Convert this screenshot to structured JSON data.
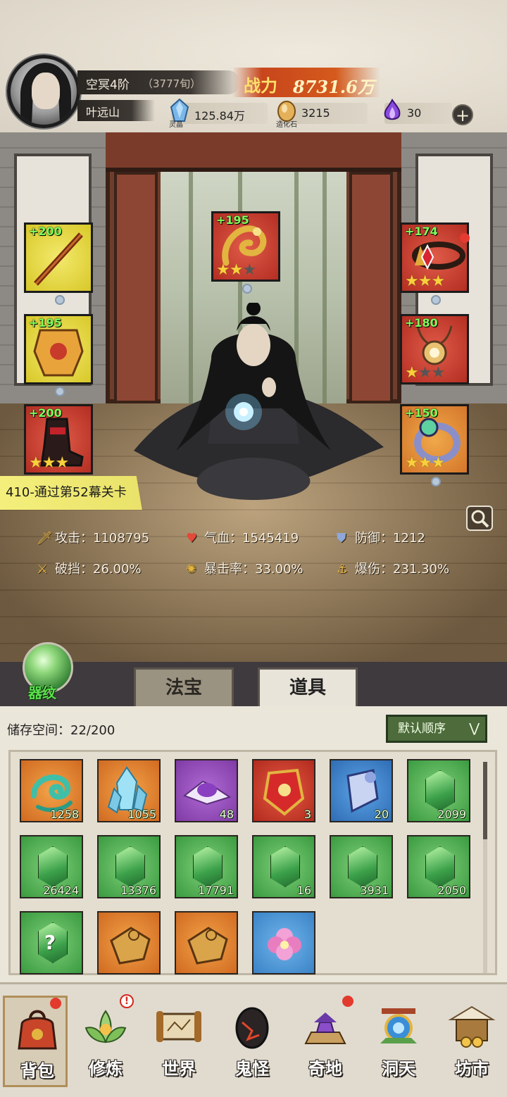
{
  "header": {
    "realm": "空冥4阶",
    "days": "（3777旬）",
    "name": "叶远山",
    "power_label": "战力",
    "power_value": "8731.6万",
    "resources": [
      {
        "label": "灵晶",
        "value": "125.84万",
        "icon": "spirit-crystal-icon",
        "color": "#7ab7e8"
      },
      {
        "label": "造化石",
        "value": "3215",
        "icon": "creation-stone-icon",
        "color": "#e3b15a"
      },
      {
        "label": "",
        "value": "30",
        "icon": "purple-flame-icon",
        "color": "#8a4be0"
      }
    ],
    "plus": "+"
  },
  "equipment": {
    "slots": [
      {
        "plus": "+200",
        "stars": 0,
        "quality": "yellow",
        "icon": "sword-icon",
        "gem": true,
        "dot": false
      },
      {
        "plus": "+195",
        "stars": 0,
        "quality": "yellow",
        "icon": "armor-icon",
        "gem": true,
        "dot": false
      },
      {
        "plus": "+200",
        "stars": 3,
        "quality": "red",
        "icon": "boots-icon",
        "gem": false,
        "dot": false
      },
      {
        "plus": "+195",
        "stars": 2,
        "quality": "red",
        "icon": "dragon-talisman-icon",
        "gem": true,
        "dot": false
      },
      {
        "plus": "+174",
        "stars": 3,
        "quality": "red",
        "icon": "crown-icon",
        "gem": true,
        "dot": true
      },
      {
        "plus": "+180",
        "stars": 1,
        "quality": "red",
        "icon": "necklace-icon",
        "gem": false,
        "dot": false
      },
      {
        "plus": "+150",
        "stars": 3,
        "quality": "orange",
        "icon": "ring-icon",
        "gem": true,
        "dot": false
      }
    ]
  },
  "stage": "410-通过第52幕关卡",
  "stats": {
    "attack_label": "攻击：",
    "attack": "1108795",
    "hp_label": "气血：",
    "hp": "1545419",
    "defense_label": "防御：",
    "defense": "1212",
    "pierce_label": "破挡：",
    "pierce": "26.00%",
    "crit_label": "暴击率：",
    "crit": "33.00%",
    "critdmg_label": "爆伤：",
    "critdmg": "231.30%"
  },
  "qiwen_label": "器纹",
  "tabs": [
    {
      "label": "法宝",
      "active": false
    },
    {
      "label": "道具",
      "active": true
    }
  ],
  "bag": {
    "storage_label": "储存空间：",
    "storage_value": "22/200",
    "sort_label": "默认顺序",
    "items": [
      {
        "count": "1258",
        "bg": "orange",
        "icon": "wind-swirl-icon"
      },
      {
        "count": "1055",
        "bg": "orange",
        "icon": "ice-crystal-icon"
      },
      {
        "count": "48",
        "bg": "purple",
        "icon": "purple-dust-icon"
      },
      {
        "count": "3",
        "bg": "red",
        "icon": "red-talisman-icon"
      },
      {
        "count": "20",
        "bg": "blue",
        "icon": "blue-scroll-icon"
      },
      {
        "count": "2099",
        "bg": "green",
        "icon": "green-crystal-icon"
      },
      {
        "count": "26424",
        "bg": "green",
        "icon": "green-crystal-icon"
      },
      {
        "count": "13376",
        "bg": "green",
        "icon": "green-crystal-icon"
      },
      {
        "count": "17791",
        "bg": "green",
        "icon": "green-crystal-icon"
      },
      {
        "count": "16",
        "bg": "green",
        "icon": "green-crystal-icon"
      },
      {
        "count": "3931",
        "bg": "green",
        "icon": "green-crystal-icon"
      },
      {
        "count": "2050",
        "bg": "green",
        "icon": "green-crystal-icon"
      },
      {
        "count": "",
        "bg": "green",
        "icon": "mystery-crystal-icon",
        "glyph": "?"
      },
      {
        "count": "",
        "bg": "orange",
        "icon": "puzzle-piece-icon"
      },
      {
        "count": "",
        "bg": "orange",
        "icon": "puzzle-piece-icon"
      },
      {
        "count": "",
        "bg": "lblue",
        "icon": "flower-icon"
      }
    ]
  },
  "nav": [
    {
      "label": "背包",
      "icon": "bag-icon",
      "badge": "dot",
      "active": true
    },
    {
      "label": "修炼",
      "icon": "lotus-icon",
      "badge": "bang",
      "active": false
    },
    {
      "label": "世界",
      "icon": "scroll-map-icon",
      "badge": "",
      "active": false
    },
    {
      "label": "鬼怪",
      "icon": "demon-egg-icon",
      "badge": "",
      "active": false
    },
    {
      "label": "奇地",
      "icon": "pagoda-icon",
      "badge": "dot",
      "active": false
    },
    {
      "label": "洞天",
      "icon": "portal-icon",
      "badge": "",
      "active": false
    },
    {
      "label": "坊市",
      "icon": "market-stall-icon",
      "badge": "",
      "active": false
    }
  ],
  "badge_bang": "!"
}
